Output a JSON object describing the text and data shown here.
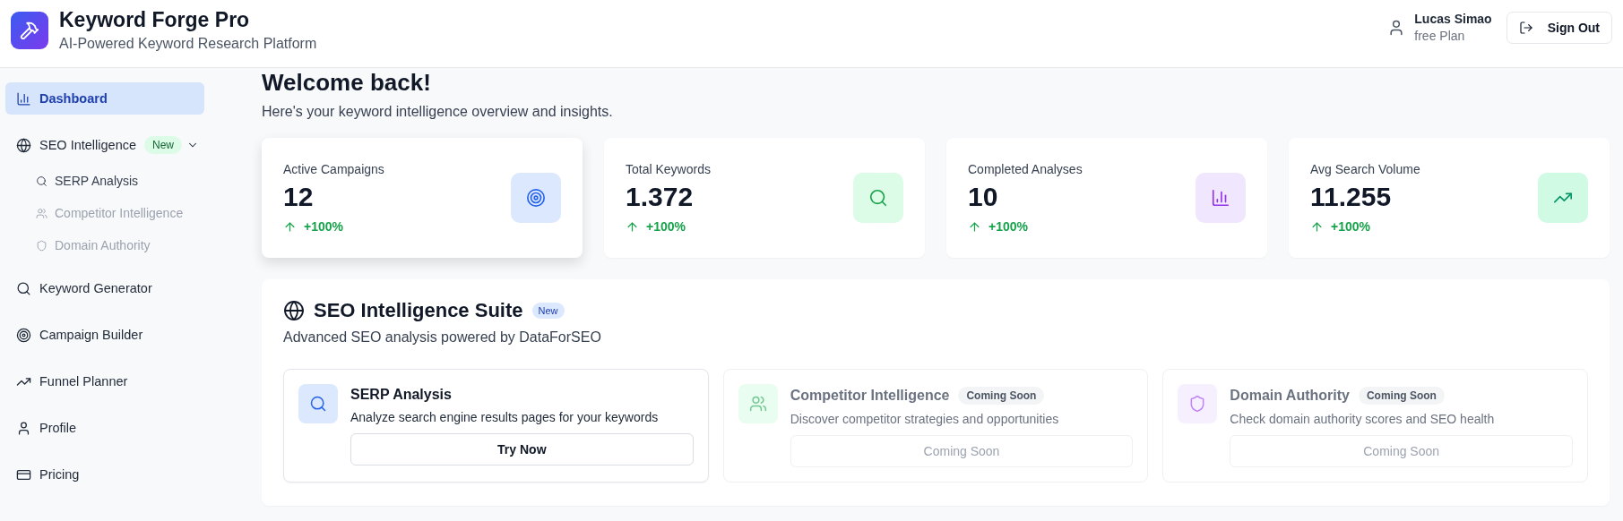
{
  "header": {
    "title": "Keyword Forge Pro",
    "subtitle": "AI-Powered Keyword Research Platform",
    "user": {
      "name": "Lucas Simao",
      "plan": "free Plan"
    },
    "sign_out": "Sign Out"
  },
  "sidebar": {
    "items": [
      {
        "label": "Dashboard",
        "kind": "chart",
        "selected": true
      },
      {
        "label": "SEO Intelligence",
        "kind": "globe",
        "selected": false,
        "badge": "New",
        "expanded": true,
        "children": [
          {
            "label": "SERP Analysis",
            "kind": "search",
            "disabled": false
          },
          {
            "label": "Competitor Intelligence",
            "kind": "users",
            "disabled": true
          },
          {
            "label": "Domain Authority",
            "kind": "shield",
            "disabled": true
          }
        ]
      },
      {
        "label": "Keyword Generator",
        "kind": "search",
        "selected": false
      },
      {
        "label": "Campaign Builder",
        "kind": "target",
        "selected": false
      },
      {
        "label": "Funnel Planner",
        "kind": "trend",
        "selected": false
      },
      {
        "label": "Profile",
        "kind": "user",
        "selected": false
      },
      {
        "label": "Pricing",
        "kind": "card",
        "selected": false
      }
    ]
  },
  "main": {
    "heading": "Welcome back!",
    "subheading": "Here's your keyword intelligence overview and insights.",
    "stats": [
      {
        "label": "Active Campaigns",
        "value": "12",
        "change": "+100%",
        "kind": "target",
        "selected": true
      },
      {
        "label": "Total Keywords",
        "value": "1.372",
        "change": "+100%",
        "kind": "search",
        "selected": false
      },
      {
        "label": "Completed Analyses",
        "value": "10",
        "change": "+100%",
        "kind": "chart",
        "selected": false
      },
      {
        "label": "Avg Search Volume",
        "value": "11.255",
        "change": "+100%",
        "kind": "trend",
        "selected": false
      }
    ],
    "suite": {
      "title": "SEO Intelligence Suite",
      "badge": "New",
      "subtitle": "Advanced SEO analysis powered by DataForSEO",
      "tools": [
        {
          "kind": "search",
          "title": "SERP Analysis",
          "description": "Analyze search engine results pages for your keywords",
          "button": "Try Now",
          "disabled": false
        },
        {
          "kind": "users",
          "title": "Competitor Intelligence",
          "badge": "Coming Soon",
          "description": "Discover competitor strategies and opportunities",
          "button": "Coming Soon",
          "disabled": true
        },
        {
          "kind": "shield",
          "title": "Domain Authority",
          "badge": "Coming Soon",
          "description": "Check domain authority scores and SEO health",
          "button": "Coming Soon",
          "disabled": true
        }
      ]
    }
  }
}
